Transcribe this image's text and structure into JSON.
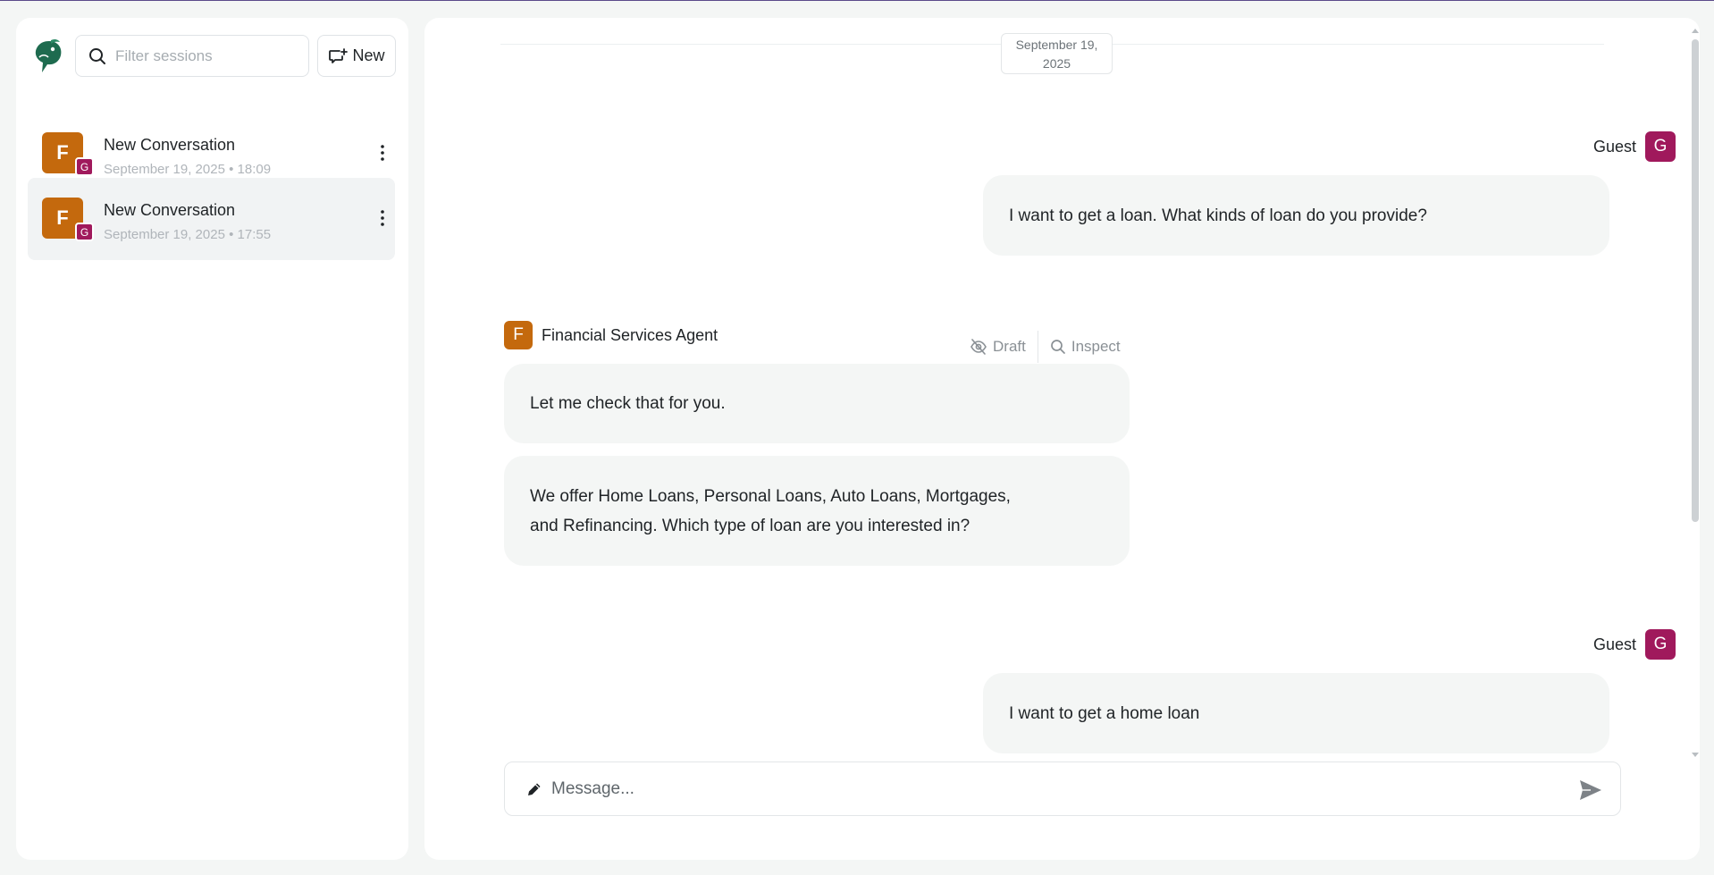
{
  "sidebar": {
    "logo_icon": "parrot-logo-icon",
    "search": {
      "placeholder": "Filter sessions",
      "value": ""
    },
    "new_button_label": "New",
    "sessions": [
      {
        "title": "New Conversation",
        "date": "September 19, 2025 • 18:09",
        "avatar": "F",
        "badge": "G",
        "selected": false
      },
      {
        "title": "New Conversation",
        "date": "September 19, 2025 • 17:55",
        "avatar": "F",
        "badge": "G",
        "selected": true
      }
    ]
  },
  "chat": {
    "date_separator": "September 19, 2025",
    "messages": [
      {
        "sender": "Guest",
        "avatar": "G",
        "text": "I want to get a loan. What kinds of loan do you provide?"
      },
      {
        "sender": "Financial Services Agent",
        "avatar": "F",
        "actions": {
          "draft": "Draft",
          "inspect": "Inspect"
        },
        "bubbles": [
          "Let me check that for you.",
          "We offer Home Loans, Personal Loans, Auto Loans, Mortgages, and Refinancing. Which type of loan are you interested in?"
        ]
      },
      {
        "sender": "Guest",
        "avatar": "G",
        "text": "I want to get a home loan"
      }
    ],
    "composer": {
      "placeholder": "Message...",
      "value": ""
    }
  },
  "colors": {
    "agent_accent": "#c4690d",
    "guest_accent": "#a0195c",
    "logo": "#1e6b4f",
    "bubble_bg": "#f4f6f5"
  }
}
